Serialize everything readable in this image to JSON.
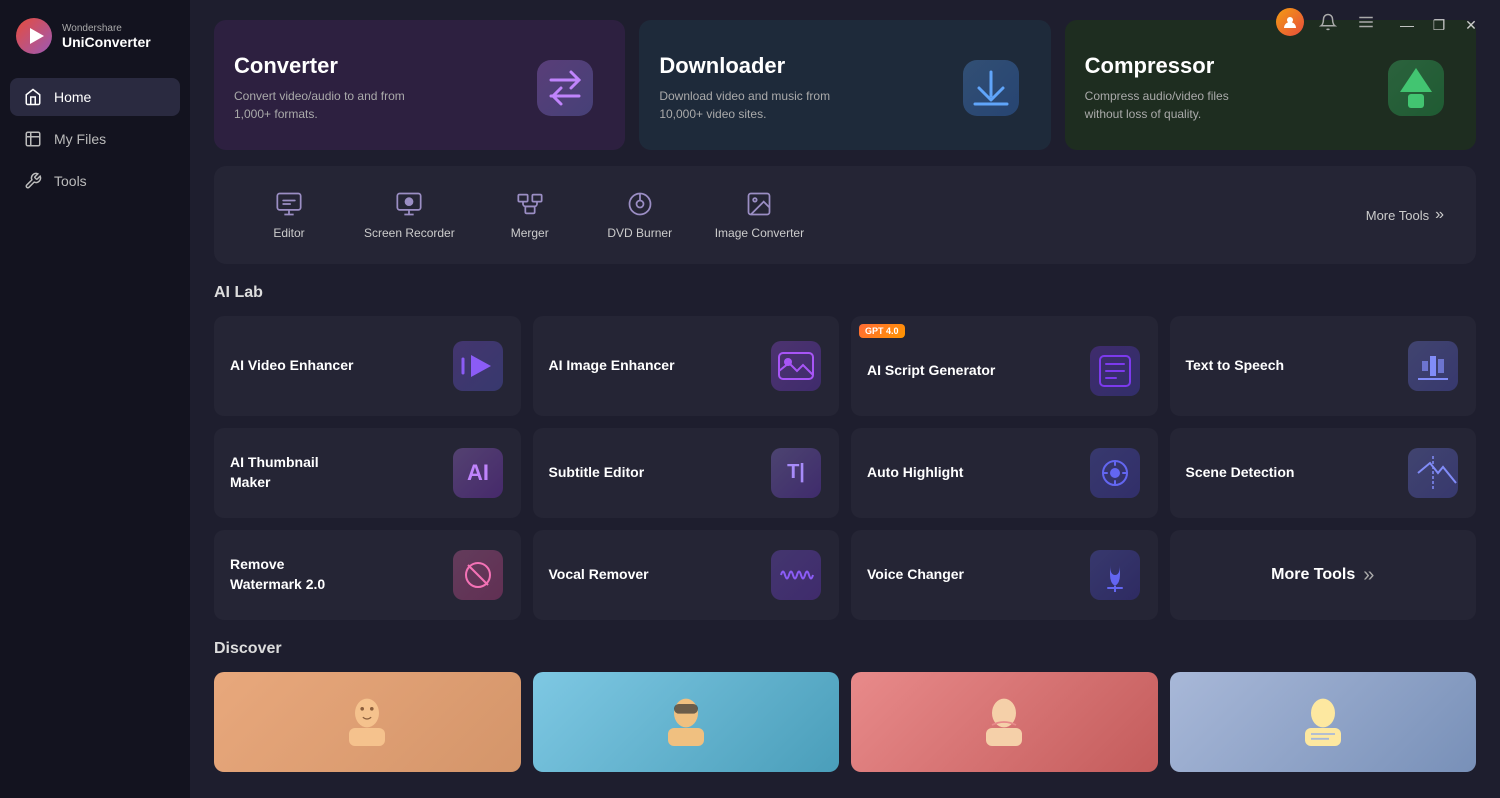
{
  "app": {
    "brand": "Wondershare",
    "product": "UniConverter"
  },
  "sidebar": {
    "items": [
      {
        "id": "home",
        "label": "Home",
        "active": true
      },
      {
        "id": "my-files",
        "label": "My Files",
        "active": false
      },
      {
        "id": "tools",
        "label": "Tools",
        "active": false
      }
    ]
  },
  "hero_cards": [
    {
      "id": "converter",
      "title": "Converter",
      "desc": "Convert video/audio to and from 1,000+ formats.",
      "bg": "#2d2040"
    },
    {
      "id": "downloader",
      "title": "Downloader",
      "desc": "Download video and music from 10,000+ video sites.",
      "bg": "#1e2a3a"
    },
    {
      "id": "compressor",
      "title": "Compressor",
      "desc": "Compress audio/video files without loss of quality.",
      "bg": "#1e2d20"
    }
  ],
  "tools": {
    "items": [
      {
        "id": "editor",
        "label": "Editor"
      },
      {
        "id": "screen-recorder",
        "label": "Screen Recorder"
      },
      {
        "id": "merger",
        "label": "Merger"
      },
      {
        "id": "dvd-burner",
        "label": "DVD Burner"
      },
      {
        "id": "image-converter",
        "label": "Image Converter"
      }
    ],
    "more_label": "More Tools"
  },
  "ai_lab": {
    "section_title": "AI Lab",
    "items": [
      {
        "id": "ai-video-enhancer",
        "title": "AI Video Enhancer",
        "badge": null,
        "row": 0
      },
      {
        "id": "ai-image-enhancer",
        "title": "AI Image Enhancer",
        "badge": null,
        "row": 0
      },
      {
        "id": "ai-script-generator",
        "title": "AI Script Generator",
        "badge": "GPT 4.0",
        "row": 0
      },
      {
        "id": "text-to-speech",
        "title": "Text to Speech",
        "badge": null,
        "row": 0
      },
      {
        "id": "ai-thumbnail-maker",
        "title": "AI Thumbnail Maker",
        "badge": null,
        "row": 1
      },
      {
        "id": "subtitle-editor",
        "title": "Subtitle Editor",
        "badge": null,
        "row": 1
      },
      {
        "id": "auto-highlight",
        "title": "Auto Highlight",
        "badge": null,
        "row": 1
      },
      {
        "id": "scene-detection",
        "title": "Scene Detection",
        "badge": null,
        "row": 1
      },
      {
        "id": "remove-watermark",
        "title": "Remove Watermark 2.0",
        "badge": null,
        "row": 2
      },
      {
        "id": "vocal-remover",
        "title": "Vocal Remover",
        "badge": null,
        "row": 2
      },
      {
        "id": "voice-changer",
        "title": "Voice Changer",
        "badge": null,
        "row": 2
      },
      {
        "id": "more-tools-ai",
        "title": "More Tools",
        "badge": null,
        "row": 2
      }
    ]
  },
  "discover": {
    "section_title": "Discover",
    "items": [
      {
        "id": "disc-1",
        "bg": "#e8a87c"
      },
      {
        "id": "disc-2",
        "bg": "#7ec8e3"
      },
      {
        "id": "disc-3",
        "bg": "#d4a5a5"
      },
      {
        "id": "disc-4",
        "bg": "#a8b8d8"
      }
    ]
  },
  "window": {
    "minimize": "—",
    "maximize": "❐",
    "close": "✕"
  }
}
